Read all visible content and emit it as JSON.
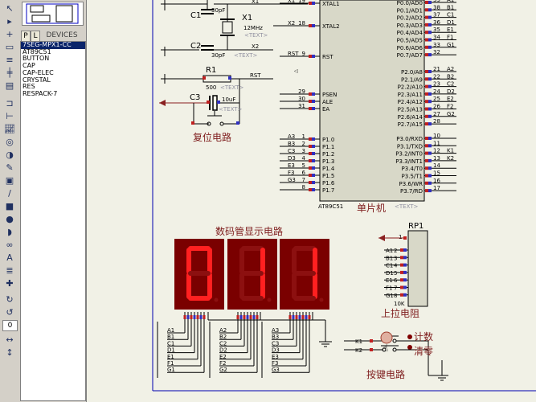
{
  "devices_panel": {
    "mode_p": "P",
    "mode_l": "L",
    "title": "DEVICES",
    "items": [
      "7SEG-MPX1-CC",
      "AT89C51",
      "BUTTON",
      "CAP",
      "CAP-ELEC",
      "CRYSTAL",
      "RES",
      "RESPACK-7"
    ],
    "selected_index": 0
  },
  "toolbar": {
    "zoom_value": "0"
  },
  "schematic": {
    "oscillator": {
      "c1": "C1",
      "c1_val": "30pF",
      "c2": "C2",
      "c2_val": "30pF",
      "x1": "X1",
      "x1_val": "12MHz",
      "text_ph": "<TEXT>",
      "x1_net": "X1",
      "x2_net": "X2"
    },
    "reset": {
      "r1": "R1",
      "r1_val": "500",
      "c3": "C3",
      "c3_val": "10uF",
      "rst_net": "RST",
      "title": "复位电路"
    },
    "mcu": {
      "title": "单片机",
      "part": "AT89C51",
      "text_ph": "<TEXT>",
      "left_pins": [
        {
          "num": "19",
          "name": "XTAL1",
          "net": "X1"
        },
        {
          "num": "18",
          "name": "XTAL2",
          "net": "X2"
        },
        {
          "num": "9",
          "name": "RST",
          "net": "RST"
        },
        {
          "num": "29",
          "name": "PSEN",
          "net": ""
        },
        {
          "num": "30",
          "name": "ALE",
          "net": ""
        },
        {
          "num": "31",
          "name": "EA",
          "net": ""
        },
        {
          "num": "1",
          "name": "P1.0",
          "net": "A3"
        },
        {
          "num": "2",
          "name": "P1.1",
          "net": "B3"
        },
        {
          "num": "3",
          "name": "P1.2",
          "net": "C3"
        },
        {
          "num": "4",
          "name": "P1.3",
          "net": "D3"
        },
        {
          "num": "5",
          "name": "P1.4",
          "net": "E3"
        },
        {
          "num": "6",
          "name": "P1.5",
          "net": "F3"
        },
        {
          "num": "7",
          "name": "P1.6",
          "net": "G3"
        },
        {
          "num": "8",
          "name": "P1.7",
          "net": ""
        }
      ],
      "right_pins": [
        {
          "num": "39",
          "name": "P0.0/AD0",
          "net": "A1"
        },
        {
          "num": "38",
          "name": "P0.1/AD1",
          "net": "B1"
        },
        {
          "num": "37",
          "name": "P0.2/AD2",
          "net": "C1"
        },
        {
          "num": "36",
          "name": "P0.3/AD3",
          "net": "D1"
        },
        {
          "num": "35",
          "name": "P0.4/AD4",
          "net": "E1"
        },
        {
          "num": "34",
          "name": "P0.5/AD5",
          "net": "F1"
        },
        {
          "num": "33",
          "name": "P0.6/AD6",
          "net": "G1"
        },
        {
          "num": "32",
          "name": "P0.7/AD7",
          "net": ""
        },
        {
          "num": "21",
          "name": "P2.0/A8",
          "net": "A2"
        },
        {
          "num": "22",
          "name": "P2.1/A9",
          "net": "B2"
        },
        {
          "num": "23",
          "name": "P2.2/A10",
          "net": "C2"
        },
        {
          "num": "24",
          "name": "P2.3/A11",
          "net": "D2"
        },
        {
          "num": "25",
          "name": "P2.4/A12",
          "net": "E2"
        },
        {
          "num": "26",
          "name": "P2.5/A13",
          "net": "F2"
        },
        {
          "num": "27",
          "name": "P2.6/A14",
          "net": "G2"
        },
        {
          "num": "28",
          "name": "P2.7/A15",
          "net": ""
        },
        {
          "num": "10",
          "name": "P3.0/RXD",
          "net": ""
        },
        {
          "num": "11",
          "name": "P3.1/TXD",
          "net": ""
        },
        {
          "num": "12",
          "name": "P3.2/INT0",
          "net": "K1"
        },
        {
          "num": "13",
          "name": "P3.3/INT1",
          "net": "K2"
        },
        {
          "num": "14",
          "name": "P3.4/T0",
          "net": ""
        },
        {
          "num": "15",
          "name": "P3.5/T1",
          "net": ""
        },
        {
          "num": "16",
          "name": "P3.6/WR",
          "net": ""
        },
        {
          "num": "17",
          "name": "P3.7/RD",
          "net": ""
        }
      ]
    },
    "display": {
      "title": "数码管显示电路",
      "digits": [
        "0",
        "1",
        "1"
      ],
      "bus1": [
        "A1",
        "B1",
        "C1",
        "D1",
        "E1",
        "F1",
        "G1"
      ],
      "bus2": [
        "A2",
        "B2",
        "C2",
        "D2",
        "E2",
        "F2",
        "G2"
      ],
      "bus3": [
        "A3",
        "B3",
        "C3",
        "D3",
        "E3",
        "F3",
        "G3"
      ]
    },
    "pullup": {
      "ref": "RP1",
      "value": "10K",
      "title": "上拉电阻",
      "pin1": "1",
      "nets": [
        "A1",
        "B1",
        "C1",
        "D1",
        "E1",
        "F1",
        "G1"
      ],
      "pins": [
        "2",
        "3",
        "4",
        "5",
        "6",
        "7",
        "8"
      ]
    },
    "keys": {
      "title": "按键电路",
      "k1": "K1",
      "k2": "K2",
      "count_label": "计数",
      "clear_label": "清零"
    }
  }
}
